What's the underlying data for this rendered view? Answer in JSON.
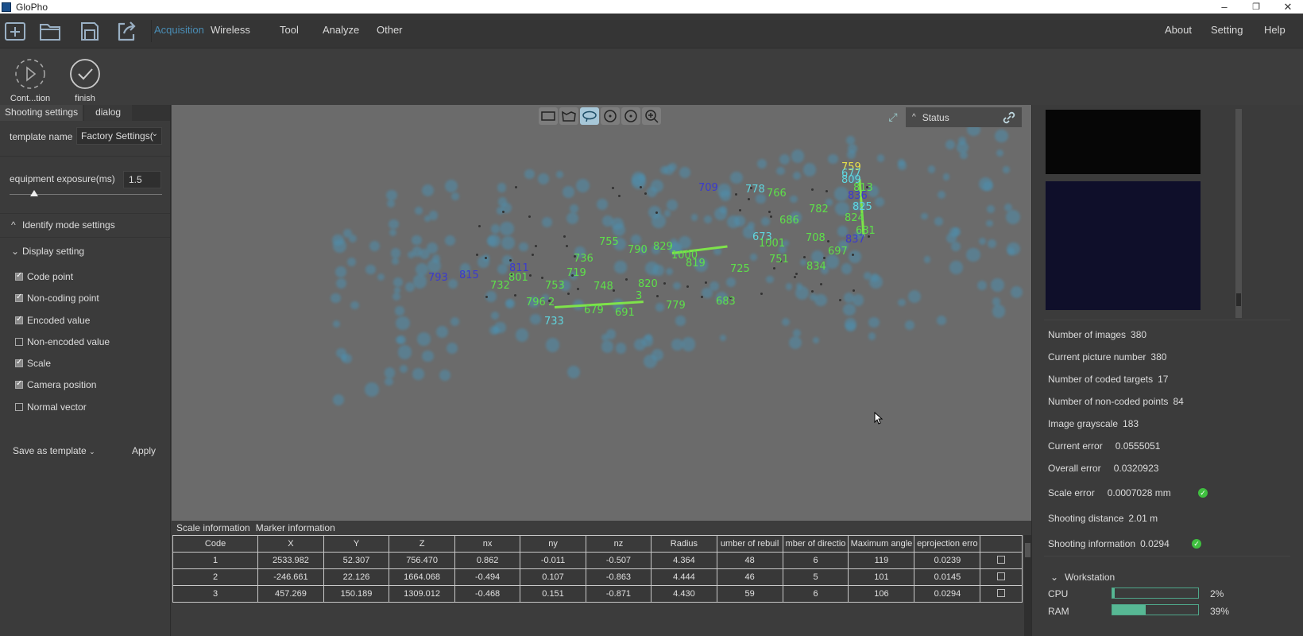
{
  "window": {
    "title": "GloPho",
    "minimize": "–",
    "maximize": "❐",
    "close": "✕"
  },
  "toolbar": {
    "icons": [
      "new-project-icon",
      "open-folder-icon",
      "save-icon",
      "export-icon"
    ]
  },
  "menu": {
    "left": [
      {
        "label": "Acquisition",
        "active": true
      },
      {
        "label": "Wireless"
      },
      {
        "label": "Tool"
      },
      {
        "label": "Analyze"
      },
      {
        "label": "Other"
      }
    ],
    "right": [
      {
        "label": "About"
      },
      {
        "label": "Setting"
      },
      {
        "label": "Help"
      }
    ]
  },
  "ribbon": {
    "continue_label": "Cont...tion",
    "finish_label": "finish"
  },
  "left_panel": {
    "tabs": [
      "Shooting settings",
      "dialog"
    ],
    "template_label": "template name",
    "template_value": "Factory Settings(",
    "exposure_label": "equipment exposure(ms)",
    "exposure_value": "1.5",
    "exposure_slider_fraction": 0.16,
    "identify_section": "Identify mode settings",
    "display_section": "Display setting",
    "checkboxes": [
      {
        "label": "Code point",
        "checked": true
      },
      {
        "label": "Non-coding point",
        "checked": true
      },
      {
        "label": "Encoded value",
        "checked": true
      },
      {
        "label": "Non-encoded value",
        "checked": false
      },
      {
        "label": "Scale",
        "checked": true
      },
      {
        "label": "Camera position",
        "checked": true
      },
      {
        "label": "Normal vector",
        "checked": false
      }
    ],
    "save_template_label": "Save as template",
    "apply_label": "Apply"
  },
  "viewport": {
    "tools": [
      "rect-select-icon",
      "polygon-select-icon",
      "lasso-select-icon",
      "rotate-icon",
      "rotate-reset-icon",
      "zoom-icon"
    ],
    "status_label": "Status",
    "labels": [
      {
        "text": "709",
        "color": "#3a3ad0"
      },
      {
        "text": "778",
        "color": "#5fd6e0"
      },
      {
        "text": "766",
        "color": "#5ee04a"
      },
      {
        "text": "782",
        "color": "#5ee04a"
      },
      {
        "text": "686",
        "color": "#5ee04a"
      },
      {
        "text": "759",
        "color": "#e6e04a"
      },
      {
        "text": "677",
        "color": "#5fd6e0"
      },
      {
        "text": "809",
        "color": "#5fd6e0"
      },
      {
        "text": "813",
        "color": "#5ee04a"
      },
      {
        "text": "836",
        "color": "#3a3ad0"
      },
      {
        "text": "825",
        "color": "#5fd6e0"
      },
      {
        "text": "824",
        "color": "#5ee04a"
      },
      {
        "text": "681",
        "color": "#5ee04a"
      },
      {
        "text": "837",
        "color": "#3a3ad0"
      },
      {
        "text": "673",
        "color": "#5fd6e0"
      },
      {
        "text": "1001",
        "color": "#5ee04a"
      },
      {
        "text": "708",
        "color": "#5ee04a"
      },
      {
        "text": "697",
        "color": "#5ee04a"
      },
      {
        "text": "755",
        "color": "#5ee04a"
      },
      {
        "text": "790",
        "color": "#5ee04a"
      },
      {
        "text": "829",
        "color": "#5ee04a"
      },
      {
        "text": "1000",
        "color": "#5ee04a"
      },
      {
        "text": "819",
        "color": "#5ee04a"
      },
      {
        "text": "751",
        "color": "#5ee04a"
      },
      {
        "text": "834",
        "color": "#5ee04a"
      },
      {
        "text": "725",
        "color": "#5ee04a"
      },
      {
        "text": "736",
        "color": "#5ee04a"
      },
      {
        "text": "719",
        "color": "#5ee04a"
      },
      {
        "text": "801",
        "color": "#5ee04a"
      },
      {
        "text": "811",
        "color": "#3a3ad0"
      },
      {
        "text": "793",
        "color": "#3a3ad0"
      },
      {
        "text": "815",
        "color": "#3a3ad0"
      },
      {
        "text": "732",
        "color": "#5ee04a"
      },
      {
        "text": "753",
        "color": "#5ee04a"
      },
      {
        "text": "748",
        "color": "#5ee04a"
      },
      {
        "text": "820",
        "color": "#5ee04a"
      },
      {
        "text": "796",
        "color": "#5ee04a"
      },
      {
        "text": "2",
        "color": "#5ee04a"
      },
      {
        "text": "3",
        "color": "#5ee04a"
      },
      {
        "text": "679",
        "color": "#5ee04a"
      },
      {
        "text": "691",
        "color": "#5ee04a"
      },
      {
        "text": "779",
        "color": "#5ee04a"
      },
      {
        "text": "683",
        "color": "#5ee04a"
      },
      {
        "text": "733",
        "color": "#5fd6e0"
      }
    ]
  },
  "bottom": {
    "tabs": [
      "Scale information",
      "Marker information"
    ],
    "columns": [
      "Code",
      "X",
      "Y",
      "Z",
      "nx",
      "ny",
      "nz",
      "Radius",
      "umber of rebuil",
      "mber of directio",
      "Maximum angle",
      "eprojection erro",
      ""
    ],
    "rows": [
      [
        "1",
        "2533.982",
        "52.307",
        "756.470",
        "0.862",
        "-0.011",
        "-0.507",
        "4.364",
        "48",
        "6",
        "119",
        "0.0239"
      ],
      [
        "2",
        "-246.661",
        "22.126",
        "1664.068",
        "-0.494",
        "0.107",
        "-0.863",
        "4.444",
        "46",
        "5",
        "101",
        "0.0145"
      ],
      [
        "3",
        "457.269",
        "150.189",
        "1309.012",
        "-0.468",
        "0.151",
        "-0.871",
        "4.430",
        "59",
        "6",
        "106",
        "0.0294"
      ]
    ]
  },
  "right_panel": {
    "stats": [
      {
        "label": "Number of images",
        "value": "380"
      },
      {
        "label": "Current picture number",
        "value": "380"
      },
      {
        "label": "Number of coded targets",
        "value": "17"
      },
      {
        "label": "Number of non-coded points",
        "value": "84"
      },
      {
        "label": "Image grayscale",
        "value": "183"
      },
      {
        "label": "Current error",
        "value": "0.0555051"
      },
      {
        "label": "Overall error",
        "value": "0.0320923"
      },
      {
        "label": "Scale error",
        "value": "0.0007028 mm",
        "ok": true
      },
      {
        "label": "Shooting distance",
        "value": "2.01 m"
      },
      {
        "label": "Shooting information",
        "value": "0.0294",
        "ok": true
      }
    ],
    "workstation_label": "Workstation",
    "cpu_label": "CPU",
    "cpu_value": "2%",
    "cpu_fraction": 0.02,
    "ram_label": "RAM",
    "ram_value": "39%",
    "ram_fraction": 0.39,
    "ok_color": "#3fbf3f"
  }
}
